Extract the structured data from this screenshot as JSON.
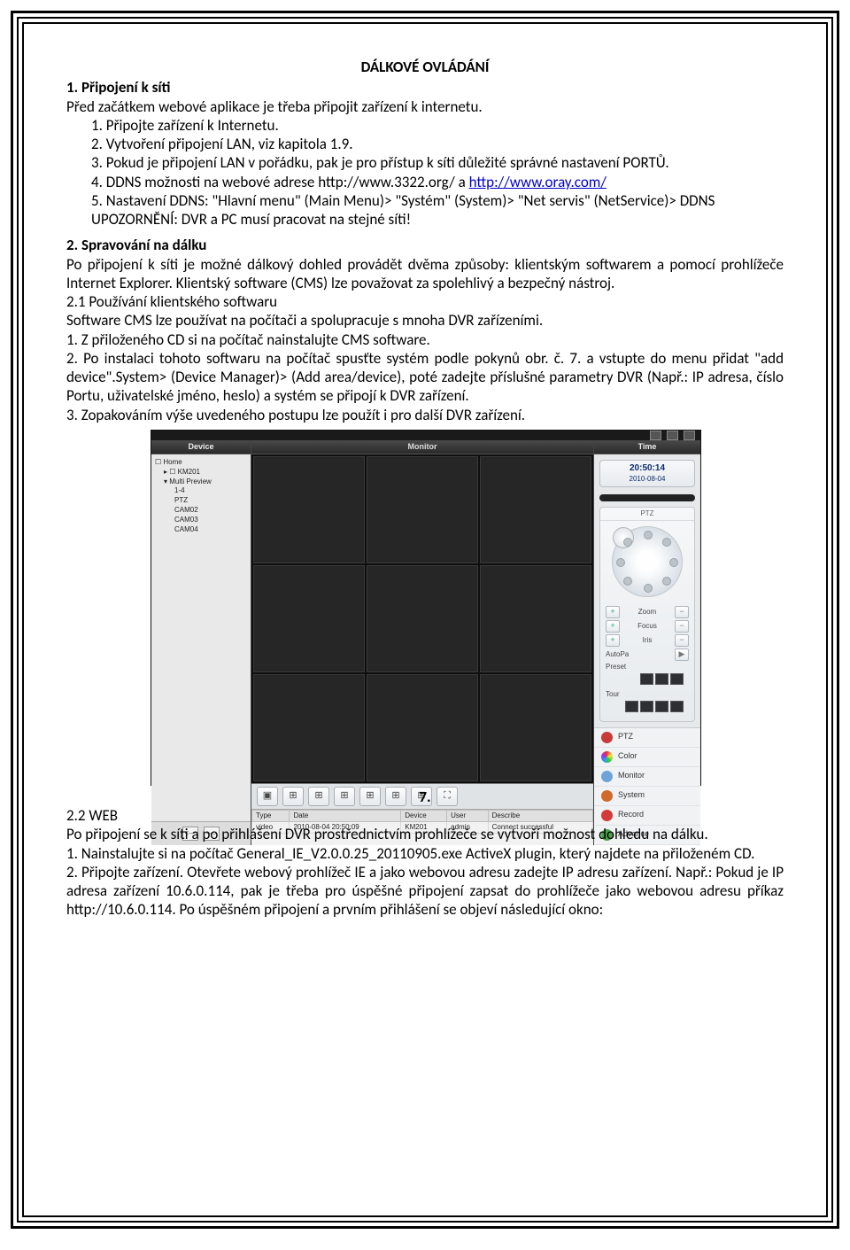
{
  "title": "DÁLKOVÉ OVLÁDÁNÍ",
  "s1": {
    "heading": "1. Připojení k síti",
    "intro": "Před začátkem webové aplikace je třeba připojit zařízení k internetu.",
    "li1": "1. Připojte zařízení k Internetu.",
    "li2": "2. Vytvoření připojení LAN, viz kapitola 1.9.",
    "li3": "3. Pokud je připojení LAN v pořádku, pak je pro přístup k síti důležité správné nastavení PORTŮ.",
    "li4a": "4. DDNS možnosti na webové adrese http://www.3322.org/ a ",
    "li4_link": "http://www.oray.com/",
    "li5": "5. Nastavení DDNS: \"Hlavní menu\" (Main Menu)> \"Systém\" (System)> \"Net servis\" (NetService)> DDNS",
    "li5b": "UPOZORNĚNÍ: DVR a PC musí pracovat na stejné síti!"
  },
  "s2": {
    "heading": "2. Spravování na dálku",
    "p1": "Po připojení k síti je možné dálkový dohled provádět dvěma způsoby: klientským softwarem a pomocí prohlížeče Internet Explorer. Klientský software (CMS) lze považovat za spolehlivý a bezpečný nástroj.",
    "h21": "2.1 Používání klientského softwaru",
    "p2": "Software CMS lze používat na počítači a spolupracuje s mnoha DVR zařízeními.",
    "p3": "1. Z přiloženého CD si na počítač nainstalujte CMS software.",
    "p4": "2. Po instalaci tohoto softwaru na počítač spusťte systém podle pokynů obr. č. 7. a vstupte do menu přidat \"add device\".System> (Device Manager)> (Add area/device), poté zadejte příslušné parametry DVR (Např.: IP adresa, číslo Portu, uživatelské jméno, heslo) a systém se připojí k DVR zařízení.",
    "p5": "3. Zopakováním výše uvedeného postupu lze použít i pro další DVR zařízení."
  },
  "fig": {
    "num": "7.",
    "device_hdr": "Device",
    "monitor_hdr": "Monitor",
    "time_hdr": "Time",
    "tree": {
      "root": "☐ Home",
      "n1": "▸ ☐ KM201",
      "n2": "▾ Multi Preview",
      "n3": "1-4",
      "n4": "PTZ",
      "n5": "CAM02",
      "n6": "CAM03",
      "n7": "CAM04"
    },
    "nav_prev": "<—",
    "nav_next": "—>",
    "clock_time": "20:50:14",
    "clock_date": "2010-08-04",
    "ptz_label": "PTZ",
    "zoom": "Zoom",
    "focus": "Focus",
    "iris": "Iris",
    "autopa": "AutoPa",
    "preset": "Preset",
    "tour": "Tour",
    "menu": {
      "ptz": "PTZ",
      "color": "Color",
      "monitor": "Monitor",
      "system": "System",
      "record": "Record",
      "advance": "Advance"
    },
    "log": {
      "h_type": "Type",
      "h_date": "Date",
      "h_device": "Device",
      "h_user": "User",
      "h_desc": "Describe",
      "r_type": "video",
      "r_date": "2010-08-04 20:50:09",
      "r_device": "KM201",
      "r_user": "admin",
      "r_desc": "Connect successful"
    }
  },
  "s22": {
    "heading": "2.2 WEB",
    "p1": "Po připojení se k síti a po přihlášení DVR prostřednictvím prohlížeče se vytvoří možnost dohledu na dálku.",
    "p2": "1. Nainstalujte si na počítač General_IE_V2.0.0.25_20110905.exe ActiveX plugin, který najdete na přiloženém CD.",
    "p3": "2. Připojte zařízení. Otevřete webový prohlížeč IE a jako webovou adresu zadejte IP adresu zařízení. Např.: Pokud je IP adresa zařízení 10.6.0.114, pak je třeba pro úspěšné připojení zapsat do prohlížeče jako webovou adresu příkaz http://10.6.0.114. Po úspěšném připojení a prvním přihlášení se objeví následující okno:"
  }
}
